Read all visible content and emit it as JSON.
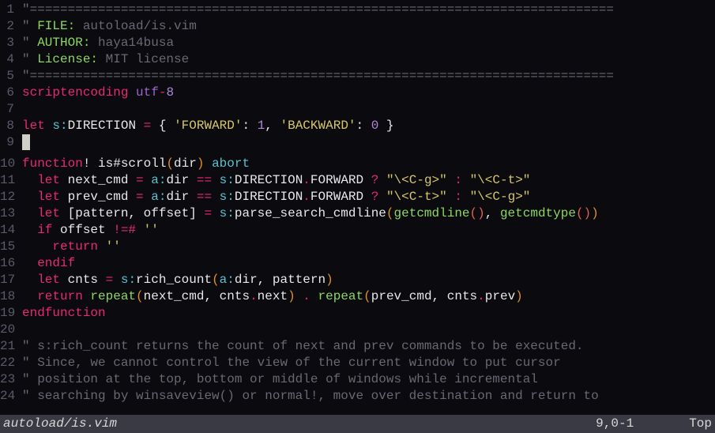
{
  "status": {
    "filename": "autoload/is.vim",
    "position": "9,0-1",
    "scroll": "Top"
  },
  "lines": [
    {
      "n": "1",
      "segs": [
        {
          "c": "c-gray",
          "t": "\""
        },
        {
          "c": "c-comment",
          "t": "============================================================================="
        }
      ]
    },
    {
      "n": "2",
      "segs": [
        {
          "c": "c-gray",
          "t": "\" "
        },
        {
          "c": "c-green",
          "t": "FILE:"
        },
        {
          "c": "c-comment",
          "t": " autoload/is.vim"
        }
      ]
    },
    {
      "n": "3",
      "segs": [
        {
          "c": "c-gray",
          "t": "\" "
        },
        {
          "c": "c-green",
          "t": "AUTHOR:"
        },
        {
          "c": "c-comment",
          "t": " haya14busa"
        }
      ]
    },
    {
      "n": "4",
      "segs": [
        {
          "c": "c-gray",
          "t": "\" "
        },
        {
          "c": "c-green",
          "t": "License:"
        },
        {
          "c": "c-comment",
          "t": " MIT license"
        }
      ]
    },
    {
      "n": "5",
      "segs": [
        {
          "c": "c-gray",
          "t": "\""
        },
        {
          "c": "c-comment",
          "t": "============================================================================="
        }
      ]
    },
    {
      "n": "6",
      "segs": [
        {
          "c": "c-pink",
          "t": "scriptencoding"
        },
        {
          "c": "c-white",
          "t": " "
        },
        {
          "c": "c-purple",
          "t": "utf"
        },
        {
          "c": "c-pink",
          "t": "-"
        },
        {
          "c": "c-num",
          "t": "8"
        }
      ]
    },
    {
      "n": "7",
      "segs": []
    },
    {
      "n": "8",
      "segs": [
        {
          "c": "c-pink",
          "t": "let"
        },
        {
          "c": "c-white",
          "t": " "
        },
        {
          "c": "c-cyan",
          "t": "s:"
        },
        {
          "c": "c-white",
          "t": "DIRECTION "
        },
        {
          "c": "c-pink",
          "t": "="
        },
        {
          "c": "c-white",
          "t": " { "
        },
        {
          "c": "c-yellow",
          "t": "'FORWARD'"
        },
        {
          "c": "c-white",
          "t": ": "
        },
        {
          "c": "c-num",
          "t": "1"
        },
        {
          "c": "c-white",
          "t": ", "
        },
        {
          "c": "c-yellow",
          "t": "'BACKWARD'"
        },
        {
          "c": "c-white",
          "t": ": "
        },
        {
          "c": "c-num",
          "t": "0"
        },
        {
          "c": "c-white",
          "t": " }"
        }
      ]
    },
    {
      "n": "9",
      "cursor": true,
      "segs": []
    },
    {
      "n": "10",
      "segs": [
        {
          "c": "c-pink",
          "t": "function"
        },
        {
          "c": "c-white",
          "t": "! is#scroll"
        },
        {
          "c": "c-orange",
          "t": "("
        },
        {
          "c": "c-white",
          "t": "dir"
        },
        {
          "c": "c-orange",
          "t": ")"
        },
        {
          "c": "c-white",
          "t": " "
        },
        {
          "c": "c-cyan",
          "t": "abort"
        }
      ]
    },
    {
      "n": "11",
      "segs": [
        {
          "c": "c-white",
          "t": "  "
        },
        {
          "c": "c-pink",
          "t": "let"
        },
        {
          "c": "c-white",
          "t": " next_cmd "
        },
        {
          "c": "c-pink",
          "t": "="
        },
        {
          "c": "c-white",
          "t": " "
        },
        {
          "c": "c-cyan",
          "t": "a:"
        },
        {
          "c": "c-white",
          "t": "dir "
        },
        {
          "c": "c-pink",
          "t": "=="
        },
        {
          "c": "c-white",
          "t": " "
        },
        {
          "c": "c-cyan",
          "t": "s:"
        },
        {
          "c": "c-white",
          "t": "DIRECTION"
        },
        {
          "c": "c-pink",
          "t": "."
        },
        {
          "c": "c-white",
          "t": "FORWARD "
        },
        {
          "c": "c-pink",
          "t": "?"
        },
        {
          "c": "c-white",
          "t": " "
        },
        {
          "c": "c-yellow",
          "t": "\"\\<C-g>\""
        },
        {
          "c": "c-white",
          "t": " "
        },
        {
          "c": "c-pink",
          "t": ":"
        },
        {
          "c": "c-white",
          "t": " "
        },
        {
          "c": "c-yellow",
          "t": "\"\\<C-t>\""
        }
      ]
    },
    {
      "n": "12",
      "segs": [
        {
          "c": "c-white",
          "t": "  "
        },
        {
          "c": "c-pink",
          "t": "let"
        },
        {
          "c": "c-white",
          "t": " prev_cmd "
        },
        {
          "c": "c-pink",
          "t": "="
        },
        {
          "c": "c-white",
          "t": " "
        },
        {
          "c": "c-cyan",
          "t": "a:"
        },
        {
          "c": "c-white",
          "t": "dir "
        },
        {
          "c": "c-pink",
          "t": "=="
        },
        {
          "c": "c-white",
          "t": " "
        },
        {
          "c": "c-cyan",
          "t": "s:"
        },
        {
          "c": "c-white",
          "t": "DIRECTION"
        },
        {
          "c": "c-pink",
          "t": "."
        },
        {
          "c": "c-white",
          "t": "FORWARD "
        },
        {
          "c": "c-pink",
          "t": "?"
        },
        {
          "c": "c-white",
          "t": " "
        },
        {
          "c": "c-yellow",
          "t": "\"\\<C-t>\""
        },
        {
          "c": "c-white",
          "t": " "
        },
        {
          "c": "c-pink",
          "t": ":"
        },
        {
          "c": "c-white",
          "t": " "
        },
        {
          "c": "c-yellow",
          "t": "\"\\<C-g>\""
        }
      ]
    },
    {
      "n": "13",
      "segs": [
        {
          "c": "c-white",
          "t": "  "
        },
        {
          "c": "c-pink",
          "t": "let"
        },
        {
          "c": "c-white",
          "t": " [pattern, offset] "
        },
        {
          "c": "c-pink",
          "t": "="
        },
        {
          "c": "c-white",
          "t": " "
        },
        {
          "c": "c-cyan",
          "t": "s:"
        },
        {
          "c": "c-white",
          "t": "parse_search_cmdline"
        },
        {
          "c": "c-orange",
          "t": "("
        },
        {
          "c": "c-green",
          "t": "getcmdline"
        },
        {
          "c": "c-red",
          "t": "()"
        },
        {
          "c": "c-white",
          "t": ", "
        },
        {
          "c": "c-green",
          "t": "getcmdtype"
        },
        {
          "c": "c-red",
          "t": "()"
        },
        {
          "c": "c-orange",
          "t": ")"
        }
      ]
    },
    {
      "n": "14",
      "segs": [
        {
          "c": "c-white",
          "t": "  "
        },
        {
          "c": "c-pink",
          "t": "if"
        },
        {
          "c": "c-white",
          "t": " offset "
        },
        {
          "c": "c-pink",
          "t": "!=#"
        },
        {
          "c": "c-white",
          "t": " "
        },
        {
          "c": "c-yellow",
          "t": "''"
        }
      ]
    },
    {
      "n": "15",
      "segs": [
        {
          "c": "c-white",
          "t": "    "
        },
        {
          "c": "c-pink",
          "t": "return"
        },
        {
          "c": "c-white",
          "t": " "
        },
        {
          "c": "c-yellow",
          "t": "''"
        }
      ]
    },
    {
      "n": "16",
      "segs": [
        {
          "c": "c-white",
          "t": "  "
        },
        {
          "c": "c-pink",
          "t": "endif"
        }
      ]
    },
    {
      "n": "17",
      "segs": [
        {
          "c": "c-white",
          "t": "  "
        },
        {
          "c": "c-pink",
          "t": "let"
        },
        {
          "c": "c-white",
          "t": " cnts "
        },
        {
          "c": "c-pink",
          "t": "="
        },
        {
          "c": "c-white",
          "t": " "
        },
        {
          "c": "c-cyan",
          "t": "s:"
        },
        {
          "c": "c-white",
          "t": "rich_count"
        },
        {
          "c": "c-orange",
          "t": "("
        },
        {
          "c": "c-cyan",
          "t": "a:"
        },
        {
          "c": "c-white",
          "t": "dir, pattern"
        },
        {
          "c": "c-orange",
          "t": ")"
        }
      ]
    },
    {
      "n": "18",
      "segs": [
        {
          "c": "c-white",
          "t": "  "
        },
        {
          "c": "c-pink",
          "t": "return"
        },
        {
          "c": "c-white",
          "t": " "
        },
        {
          "c": "c-green",
          "t": "repeat"
        },
        {
          "c": "c-orange",
          "t": "("
        },
        {
          "c": "c-white",
          "t": "next_cmd, cnts"
        },
        {
          "c": "c-pink",
          "t": "."
        },
        {
          "c": "c-white",
          "t": "next"
        },
        {
          "c": "c-orange",
          "t": ")"
        },
        {
          "c": "c-white",
          "t": " "
        },
        {
          "c": "c-pink",
          "t": "."
        },
        {
          "c": "c-white",
          "t": " "
        },
        {
          "c": "c-green",
          "t": "repeat"
        },
        {
          "c": "c-orange",
          "t": "("
        },
        {
          "c": "c-white",
          "t": "prev_cmd, cnts"
        },
        {
          "c": "c-pink",
          "t": "."
        },
        {
          "c": "c-white",
          "t": "prev"
        },
        {
          "c": "c-orange",
          "t": ")"
        }
      ]
    },
    {
      "n": "19",
      "segs": [
        {
          "c": "c-pink",
          "t": "endfunction"
        }
      ]
    },
    {
      "n": "20",
      "segs": []
    },
    {
      "n": "21",
      "segs": [
        {
          "c": "c-gray",
          "t": "\" "
        },
        {
          "c": "c-comment",
          "t": "s:rich_count returns the count of next and prev commands to be executed."
        }
      ]
    },
    {
      "n": "22",
      "segs": [
        {
          "c": "c-gray",
          "t": "\" "
        },
        {
          "c": "c-comment",
          "t": "Since, we cannot control the view of the current window to put cursor"
        }
      ]
    },
    {
      "n": "23",
      "segs": [
        {
          "c": "c-gray",
          "t": "\" "
        },
        {
          "c": "c-comment",
          "t": "position at the top, bottom or middle of windows while incremental"
        }
      ]
    },
    {
      "n": "24",
      "segs": [
        {
          "c": "c-gray",
          "t": "\" "
        },
        {
          "c": "c-comment",
          "t": "searching by winsaveview() or normal!, move over destination and return to"
        }
      ]
    }
  ]
}
